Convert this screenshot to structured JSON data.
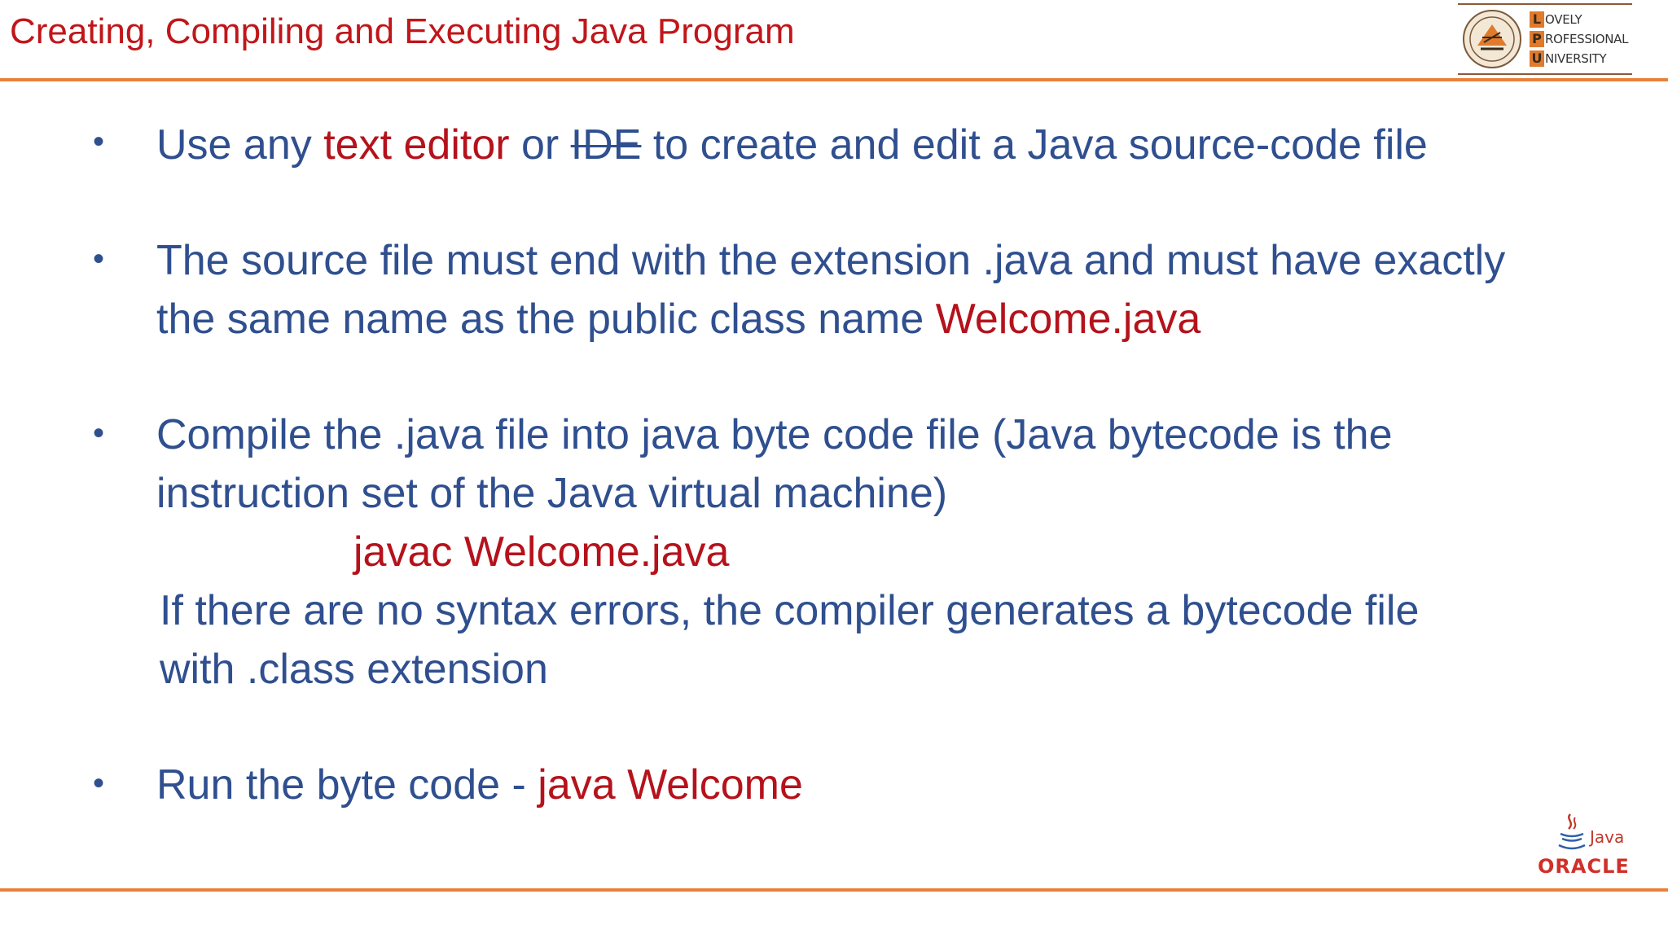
{
  "slide": {
    "title": "Creating, Compiling and Executing Java Program"
  },
  "logo": {
    "letters": [
      "L",
      "P",
      "U"
    ],
    "words": [
      "OVELY",
      "ROFESSIONAL",
      "NIVERSITY"
    ]
  },
  "bullets": [
    {
      "parts": [
        "Use any ",
        "text editor",
        " or ",
        "IDE",
        " to create and edit a Java source-code file"
      ]
    },
    {
      "line1": "The source file must end with the extension .java and must have exactly",
      "line2_plain": "the same name as the public class name ",
      "line2_red": "Welcome.java"
    },
    {
      "line1": "Compile the .java file into java byte code file (Java bytecode is the",
      "line2": "instruction set of the Java virtual machine)",
      "command": "javac Welcome.java",
      "note1": "If there are no syntax errors, the compiler generates a bytecode file",
      "note2": "with  .class extension"
    },
    {
      "plain": "Run the byte code - ",
      "red": "java Welcome"
    }
  ],
  "footer_logo": {
    "java": "Java",
    "oracle": "ORACLE"
  },
  "colors": {
    "title": "#c0161a",
    "body": "#2f4f8f",
    "highlight": "#b5121b",
    "rule": "#e8803a"
  }
}
